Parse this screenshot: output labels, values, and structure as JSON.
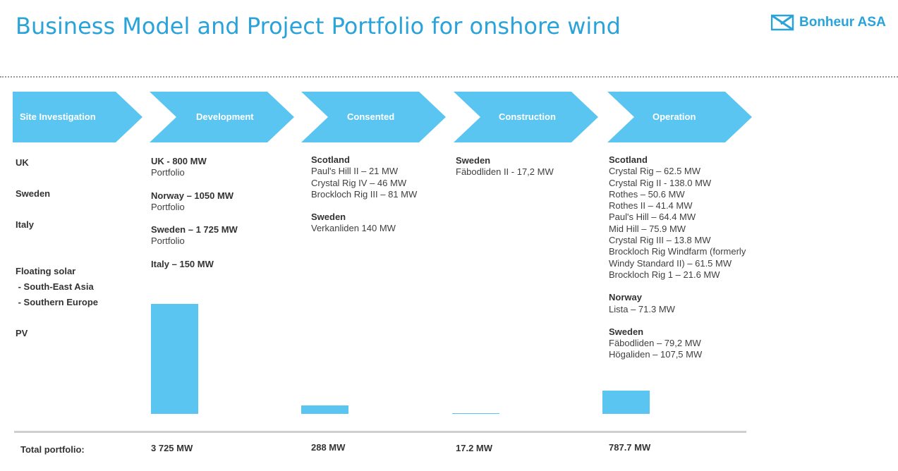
{
  "header": {
    "title": "Business Model and Project Portfolio for onshore wind"
  },
  "logo": {
    "text": "Bonheur ASA"
  },
  "stages": [
    {
      "label": "Site Investigation"
    },
    {
      "label": "Development"
    },
    {
      "label": "Consented"
    },
    {
      "label": "Construction"
    },
    {
      "label": "Operation"
    }
  ],
  "site_investigation": {
    "uk": "UK",
    "sweden": "Sweden",
    "italy": "Italy",
    "floating_solar": "Floating solar",
    "se_asia": " - South-East Asia",
    "s_europe": " - Southern Europe",
    "pv": "PV"
  },
  "development": [
    {
      "head": "UK - 800 MW",
      "sub": "Portfolio"
    },
    {
      "head": "Norway – 1050 MW",
      "sub": "Portfolio"
    },
    {
      "head": "Sweden – 1 725 MW",
      "sub": "Portfolio"
    },
    {
      "head": "Italy – 150 MW",
      "sub": ""
    }
  ],
  "consented": [
    {
      "head": "Scotland",
      "items": [
        "Paul's Hill II – 21 MW",
        "Crystal Rig IV – 46 MW",
        "Brockloch Rig III – 81 MW"
      ]
    },
    {
      "head": "Sweden",
      "items": [
        "Verkanliden 140 MW"
      ]
    }
  ],
  "construction": [
    {
      "head": "Sweden",
      "items": [
        "Fäbodliden II - 17,2 MW"
      ]
    }
  ],
  "operation": [
    {
      "head": "Scotland",
      "items": [
        "Crystal Rig – 62.5 MW",
        "Crystal Rig II  - 138.0 MW",
        "Rothes – 50.6 MW",
        "Rothes II – 41.4 MW",
        "Paul's Hill – 64.4 MW",
        "Mid Hill – 75.9 MW",
        "Crystal Rig III – 13.8 MW",
        "Brockloch Rig Windfarm (formerly",
        "Windy Standard II) – 61.5 MW",
        "Brockloch Rig 1 – 21.6 MW"
      ]
    },
    {
      "head": "Norway",
      "items": [
        "Lista – 71.3 MW"
      ]
    },
    {
      "head": "Sweden",
      "items": [
        "Fäbodliden – 79,2 MW",
        "Högaliden – 107,5 MW"
      ]
    }
  ],
  "totals": {
    "label": "Total portfolio:",
    "development": "3 725 MW",
    "consented": "288 MW",
    "construction": "17.2 MW",
    "operation": "787.7 MW"
  },
  "colors": {
    "accent": "#29a3d9",
    "bar": "#5bc5f2",
    "chevron": "#5bc5f2"
  },
  "chart_data": {
    "type": "bar",
    "categories": [
      "Development",
      "Consented",
      "Construction",
      "Operation"
    ],
    "values": [
      3725,
      288,
      17.2,
      787.7
    ],
    "unit": "MW",
    "ylim": [
      0,
      3725
    ]
  }
}
